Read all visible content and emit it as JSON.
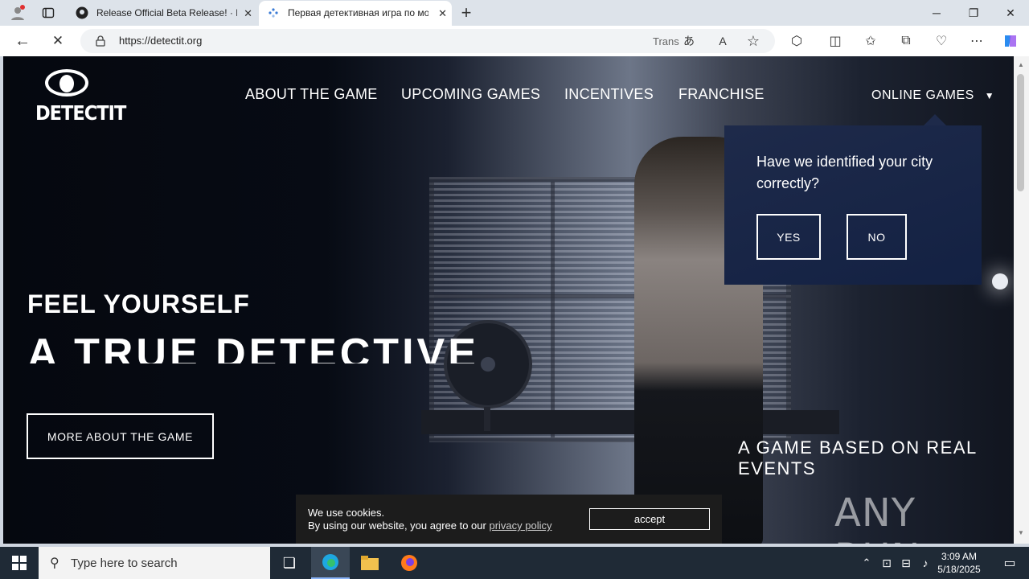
{
  "browser": {
    "tabs": [
      {
        "title": "Release Official Beta Release! · Bl"
      },
      {
        "title": "Первая детективная игра по мо"
      }
    ],
    "url": "https://detectit.org",
    "translate_label": "Trans"
  },
  "site": {
    "brand": "DETECTIT",
    "nav": [
      "ABOUT THE GAME",
      "UPCOMING GAMES",
      "INCENTIVES",
      "FRANCHISE"
    ],
    "online_games": "ONLINE GAMES",
    "hero_line1": "FEEL YOURSELF",
    "hero_line2": "A TRUE DETECTIVE",
    "more_button": "MORE ABOUT THE GAME",
    "tagline": "A GAME BASED ON REAL EVENTS",
    "city_popup": {
      "question": "Have we identified your city correctly?",
      "yes": "YES",
      "no": "NO"
    },
    "cookie": {
      "line1": "We use cookies.",
      "line2": "By using our website, you agree to our ",
      "link": "privacy policy",
      "accept": "accept"
    },
    "watermark": "ANY RUN"
  },
  "taskbar": {
    "search_placeholder": "Type here to search",
    "time": "3:09 AM",
    "date": "5/18/2025"
  }
}
